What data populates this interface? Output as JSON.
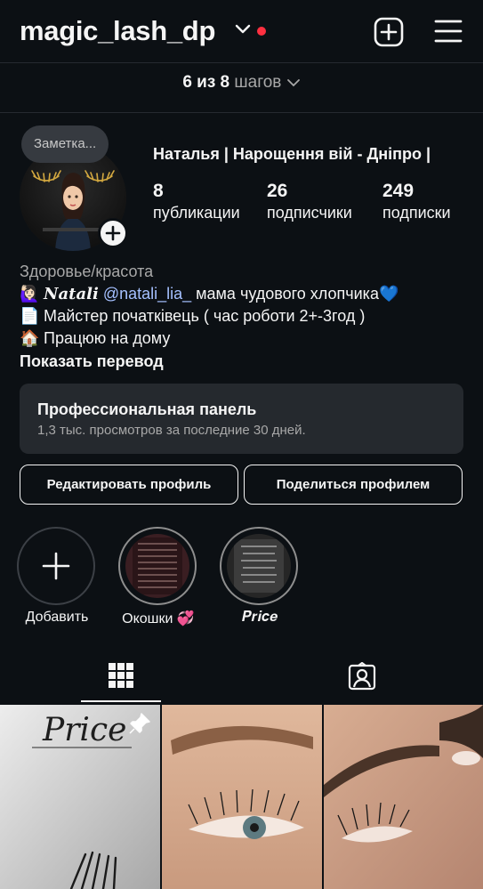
{
  "header": {
    "username": "magic_lash_dp"
  },
  "setup": {
    "progress_bold": "6 из 8",
    "progress_suffix": "шагов"
  },
  "profile": {
    "note": "Заметка...",
    "full_name": "Наталья | Нарощення вій - Дніпро |",
    "stats": [
      {
        "value": "8",
        "label": "публикации"
      },
      {
        "value": "26",
        "label": "подписчики"
      },
      {
        "value": "249",
        "label": "подписки"
      }
    ],
    "category": "Здоровье/красота",
    "bio": {
      "line1_emoji": "🙋🏻‍♀️",
      "line1_name": "𝑵𝒂𝒕𝒂𝒍𝒊",
      "line1_mention": "@natali_lia_",
      "line1_text": "мама чудового хлопчика",
      "line1_heart": "💙",
      "line2_emoji": "📄",
      "line2_text": "Майстер початківець ( час роботи 2+-3год )",
      "line3_emoji": "🏠",
      "line3_text": "Працюю на дому"
    },
    "show_translation": "Показать перевод"
  },
  "pro_panel": {
    "title": "Профессиональная панель",
    "subtitle": "1,3 тыс. просмотров за последние 30 дней."
  },
  "actions": {
    "edit_profile": "Редактировать профиль",
    "share_profile": "Поделиться профилем"
  },
  "highlights": [
    {
      "label": "Добавить"
    },
    {
      "label": "Окошки 💞"
    },
    {
      "label": "𝑷𝒓𝒊𝒄𝒆"
    }
  ],
  "posts": [
    {
      "caption_text": "Price",
      "pinned": true
    },
    {
      "caption_text": "",
      "pinned": false
    },
    {
      "caption_text": "",
      "pinned": false
    }
  ],
  "colors": {
    "background": "#0c1014",
    "surface": "#25292e",
    "text_primary": "#f5f5f5",
    "text_secondary": "#a8a8a8",
    "mention": "#a5c0ff",
    "notification_dot": "#ff3040"
  }
}
